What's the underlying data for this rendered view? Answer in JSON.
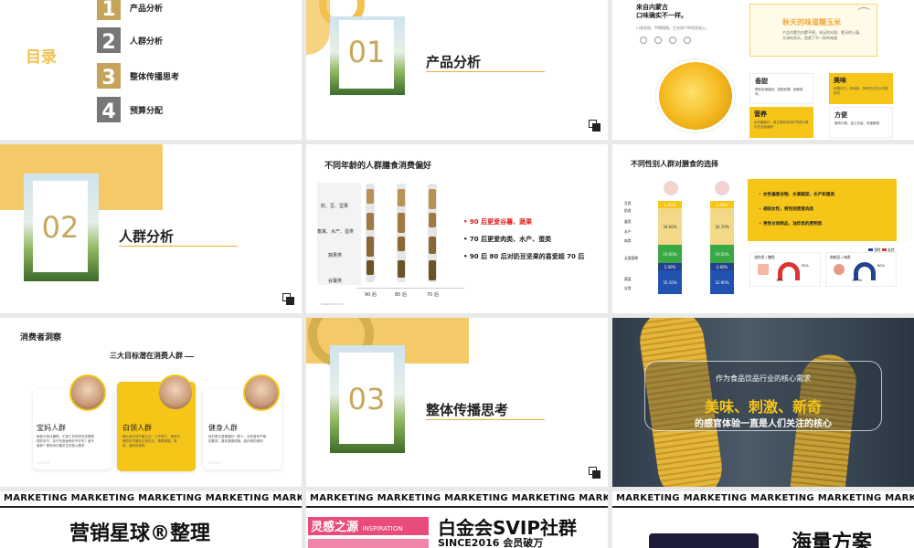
{
  "toc": {
    "title": "目录",
    "items": [
      {
        "num": "1",
        "label": "产品分析",
        "color": "#c6a35a"
      },
      {
        "num": "2",
        "label": "人群分析",
        "color": "#777777"
      },
      {
        "num": "3",
        "label": "整体传播思考",
        "color": "#c6a35a"
      },
      {
        "num": "4",
        "label": "预算分配",
        "color": "#777777"
      }
    ]
  },
  "sections": [
    {
      "num": "01",
      "title": "产品分析"
    },
    {
      "num": "02",
      "title": "人群分析"
    },
    {
      "num": "03",
      "title": "整体传播思考"
    }
  ],
  "product": {
    "headline_1": "来自内蒙古",
    "headline_2": "口味确实不一样。",
    "sub": "口感香甜、甲糯糯糯。生态原产种植更放心。",
    "highlight_title": "秋天的味道糯玉米",
    "highlight_text": "产品内蒙古内蒙平原，充足的光照、肥沃的土壤、丰沛的雨水，造就了不一样的味道",
    "features": [
      {
        "title": "香甜",
        "desc": "颗粒饱满香甜、香甜软糯、都都取有。"
      },
      {
        "title": "美味",
        "desc": "软糯可口，风味美、多种吃法怎么吃都好吃"
      },
      {
        "title": "营养",
        "desc": "含有膳食纤、维生素和多种矿物质元素补充全面营养"
      },
      {
        "title": "方便",
        "desc": "懒熟代餐、独立包装、快速解饿"
      }
    ]
  },
  "age_chart": {
    "title": "不同年龄的人群膳食消费偏好",
    "rows": [
      "奶、豆、坚果",
      "畜禽、水产、蛋类",
      "蔬果类",
      "谷薯类"
    ],
    "columns": [
      "90 后",
      "80 后",
      "70 后"
    ],
    "bullets": [
      {
        "text": "90 后更爱谷薯、蔬果",
        "highlight": true
      },
      {
        "text": "70 后更爱肉类、水产、蛋类",
        "highlight": false
      },
      {
        "text": "90 后 80 后对奶豆坚果的喜爱超 70 后",
        "highlight": false
      }
    ],
    "footer": "www.xxxxx.cn"
  },
  "gender_chart": {
    "title": "不同性别人群对膳食的选择",
    "side_labels": [
      "豆类",
      "奶类",
      "蛋类",
      "水产",
      "肉类",
      "全面营养",
      "蔬菜",
      "谷类"
    ],
    "female_values": [
      "1.00%",
      "34.60%",
      "19.00%",
      "2.00%",
      "35.10%"
    ],
    "male_values": [
      "1.00%",
      "26.70%",
      "19.50%",
      "2.60%",
      "32.90%"
    ],
    "points": [
      "女性偏爱谷物、水果蔬菜、水产和蛋类",
      "相较女性，男性则更爱肉类",
      "男性对肉制品、油炸类的更明显"
    ],
    "small_titles": [
      "油炸类 / 膳类",
      "肉制品 / 肉类"
    ],
    "legend": [
      "男性",
      "女性"
    ],
    "pcts": [
      "52%",
      "15%",
      "60%",
      "11.5%"
    ]
  },
  "consumer": {
    "title": "消费者洞察",
    "subtitle": "三大目标潜在消费人群",
    "cards": [
      {
        "name": "宝妈人群",
        "desc": "家庭与事业兼顾，忙碌工作的同时还需照顾好孩子；孩子饮食营养好不好吃？营不营养？是妈妈们最关注的核心需求"
      },
      {
        "name": "白领人群",
        "desc": "朝九晚五快节奏生活，工作繁忙，常常无暇顾及早餐的正常吃法，需要便捷、简单、营养的食物"
      },
      {
        "name": "健身人群",
        "desc": "他们是注重健康的一群人，对饮食有严格的要求，喜欢健康低脂、高纤维的食物"
      }
    ]
  },
  "insight": {
    "line1": "作为食品饮品行业的核心需求",
    "line2": "美味、刺激、新奇",
    "line3": "的感官体验一直是人们关注的核心"
  },
  "marketing": {
    "banner": "MARKETING MARKETING MARKETING MARKETING MARKETING",
    "left_title": "营销星球®整理",
    "center_pink": "灵感之源",
    "center_pink_small": "INSPIRATION",
    "center_title": "白金会SVIP社群",
    "center_since": "SINCE2016 会员破万",
    "right_title": "海量方案"
  }
}
